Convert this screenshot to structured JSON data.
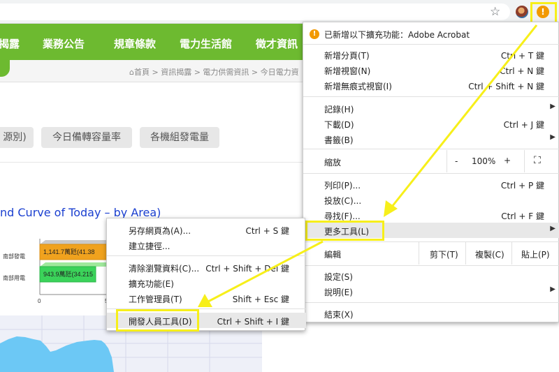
{
  "site": {
    "nav": [
      "揭露",
      "業務公告",
      "規章條款",
      "電力生活館",
      "徵才資訊"
    ],
    "breadcrumb": "⌂首頁 > 資訊揭露 > 電力供需資訊 > 今日電力資",
    "pills": [
      "源別)",
      "今日備轉容量率",
      "各機組發電量"
    ],
    "chart_title": "nd Curve of Today – by Area)"
  },
  "chart_data": {
    "type": "bar",
    "categories": [
      "南部發電",
      "南部用電"
    ],
    "values": [
      1141.7,
      943.9
    ],
    "value_labels": [
      "1,141.7萬瓩(41.38",
      "943.9萬瓩(34.215"
    ],
    "tick_labels": [
      "0",
      "5"
    ],
    "colors": [
      "#f0a21e",
      "#3bd35a"
    ]
  },
  "menu": {
    "notice": "已新增以下擴充功能：Adobe Acrobat",
    "items1": [
      {
        "label": "新增分頁(T)",
        "shortcut": "Ctrl + T 鍵"
      },
      {
        "label": "新增視窗(N)",
        "shortcut": "Ctrl + N 鍵"
      },
      {
        "label": "新增無痕式視窗(I)",
        "shortcut": "Ctrl + Shift + N 鍵"
      }
    ],
    "items2": [
      {
        "label": "記錄(H)",
        "shortcut": ""
      },
      {
        "label": "下載(D)",
        "shortcut": "Ctrl + J 鍵"
      },
      {
        "label": "書籤(B)",
        "shortcut": ""
      }
    ],
    "zoom": {
      "label": "縮放",
      "minus": "-",
      "value": "100%",
      "plus": "+",
      "fullscreen": "⛶"
    },
    "items3": [
      {
        "label": "列印(P)...",
        "shortcut": "Ctrl + P 鍵"
      },
      {
        "label": "投放(C)...",
        "shortcut": ""
      },
      {
        "label": "尋找(F)...",
        "shortcut": "Ctrl + F 鍵"
      },
      {
        "label": "更多工具(L)",
        "shortcut": ""
      }
    ],
    "edit": {
      "label": "編輯",
      "cut": "剪下(T)",
      "copy": "複製(C)",
      "paste": "貼上(P)"
    },
    "items4": [
      {
        "label": "設定(S)",
        "shortcut": ""
      },
      {
        "label": "說明(E)",
        "shortcut": ""
      }
    ],
    "exit": "結束(X)"
  },
  "submenu": {
    "items1": [
      {
        "label": "另存網頁為(A)...",
        "shortcut": "Ctrl + S 鍵"
      },
      {
        "label": "建立捷徑...",
        "shortcut": ""
      }
    ],
    "items2": [
      {
        "label": "清除瀏覽資料(C)...",
        "shortcut": "Ctrl + Shift + Del 鍵"
      },
      {
        "label": "擴充功能(E)",
        "shortcut": ""
      },
      {
        "label": "工作管理員(T)",
        "shortcut": "Shift + Esc 鍵"
      }
    ],
    "items3": [
      {
        "label": "開發人員工具(D)",
        "shortcut": "Ctrl + Shift + I 鍵"
      }
    ]
  },
  "toolbar": {
    "star": "☆",
    "alert": "!"
  },
  "colors": {
    "accent": "#6dba30",
    "highlight": "#f7ef1a",
    "alert": "#f29900"
  }
}
